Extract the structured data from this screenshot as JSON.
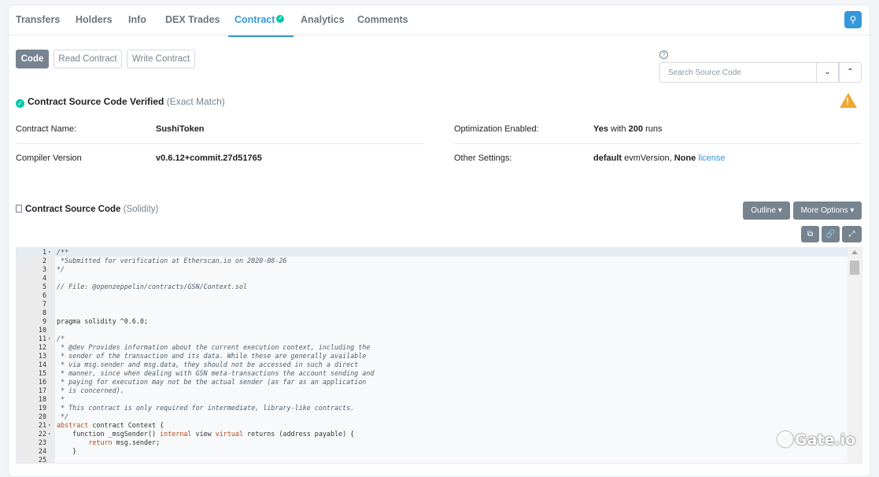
{
  "tabs": [
    "Transfers",
    "Holders",
    "Info",
    "DEX Trades",
    "Contract",
    "Analytics",
    "Comments"
  ],
  "active_tab": "Contract",
  "buttons": {
    "code": "Code",
    "read": "Read Contract",
    "write": "Write Contract"
  },
  "search": {
    "placeholder": "Search Source Code",
    "help": "?"
  },
  "verification": {
    "title": "Contract Source Code Verified",
    "match": "(Exact Match)"
  },
  "contract_info": {
    "name_label": "Contract Name:",
    "name_value": "SushiToken",
    "compiler_label": "Compiler Version",
    "compiler_value": "v0.6.12+commit.27d51765",
    "optimization_label": "Optimization Enabled:",
    "optimization_yes": "Yes",
    "optimization_with": "with",
    "optimization_runs": "200",
    "optimization_runs_suffix": "runs",
    "settings_label": "Other Settings:",
    "settings_default": "default",
    "settings_evm": "evmVersion,",
    "settings_none": "None",
    "settings_license": "license"
  },
  "source": {
    "title": "Contract Source Code",
    "lang": "(Solidity)",
    "outline": "Outline",
    "more": "More Options"
  },
  "code_lines": [
    {
      "n": "1",
      "t": "/**",
      "c": true,
      "f": true
    },
    {
      "n": "2",
      "t": " *Submitted for verification at Etherscan.io on 2020-08-26",
      "c": true
    },
    {
      "n": "3",
      "t": "*/",
      "c": true
    },
    {
      "n": "4",
      "t": ""
    },
    {
      "n": "5",
      "t": "// File: @openzeppelin/contracts/GSN/Context.sol",
      "c": true
    },
    {
      "n": "6",
      "t": ""
    },
    {
      "n": "7",
      "t": ""
    },
    {
      "n": "8",
      "t": ""
    },
    {
      "n": "9",
      "t": "pragma solidity ^0.6.0;"
    },
    {
      "n": "10",
      "t": ""
    },
    {
      "n": "11",
      "t": "/*",
      "c": true,
      "f": true
    },
    {
      "n": "12",
      "t": " * @dev Provides information about the current execution context, including the",
      "c": true
    },
    {
      "n": "13",
      "t": " * sender of the transaction and its data. While these are generally available",
      "c": true
    },
    {
      "n": "14",
      "t": " * via msg.sender and msg.data, they should not be accessed in such a direct",
      "c": true
    },
    {
      "n": "15",
      "t": " * manner, since when dealing with GSN meta-transactions the account sending and",
      "c": true
    },
    {
      "n": "16",
      "t": " * paying for execution may not be the actual sender (as far as an application",
      "c": true
    },
    {
      "n": "17",
      "t": " * is concerned).",
      "c": true
    },
    {
      "n": "18",
      "t": " *",
      "c": true
    },
    {
      "n": "19",
      "t": " * This contract is only required for intermediate, library-like contracts.",
      "c": true
    },
    {
      "n": "20",
      "t": " */",
      "c": true
    },
    {
      "n": "21",
      "t": "abstract contract Context {",
      "f": true
    },
    {
      "n": "22",
      "t": "    function _msgSender() internal view virtual returns (address payable) {",
      "f": true
    },
    {
      "n": "23",
      "t": "        return msg.sender;"
    },
    {
      "n": "24",
      "t": "    }"
    },
    {
      "n": "25",
      "t": ""
    }
  ],
  "colors": {
    "accent": "#3498db",
    "verified": "#00c9a7",
    "warning": "#f0a732",
    "button_gray": "#77838f"
  },
  "icons": [
    "search-icon",
    "verified-check-icon",
    "warning-icon",
    "file-icon",
    "copy-icon",
    "link-icon",
    "fullscreen-icon",
    "chevron-down-icon",
    "chevron-up-icon"
  ]
}
